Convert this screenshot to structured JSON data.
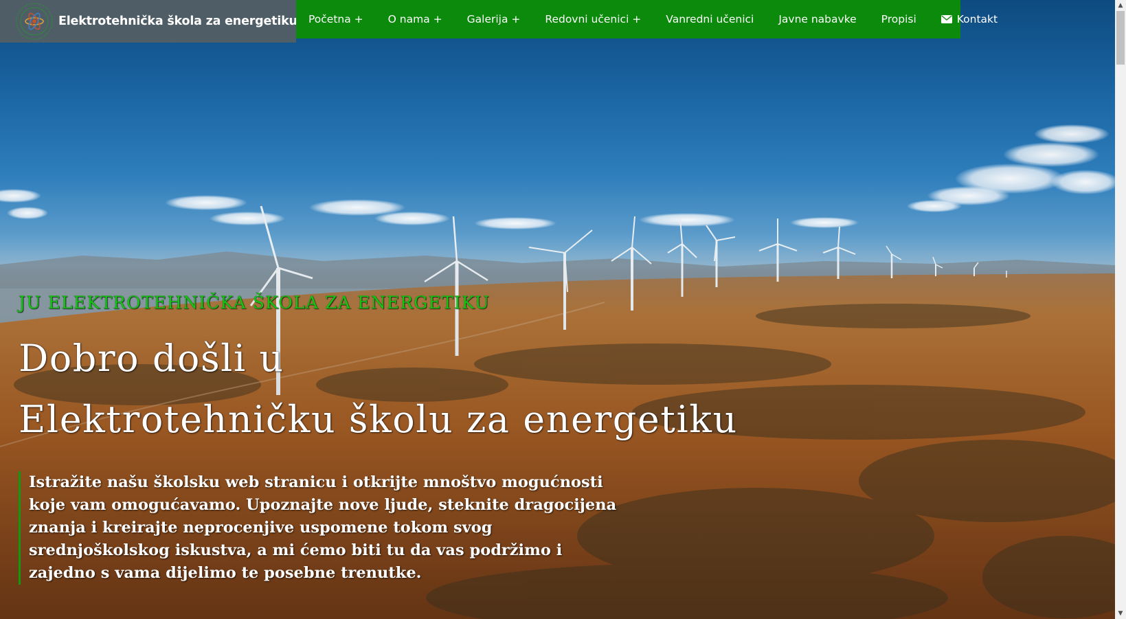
{
  "header": {
    "brand_title": "Elektrotehnička škola za energetiku",
    "logo_icon": "school-emblem-icon",
    "brand_background": "#555e64"
  },
  "nav": {
    "background": "#0b8a0b",
    "items": [
      {
        "label": "Početna +"
      },
      {
        "label": "O nama +"
      },
      {
        "label": "Galerija +"
      },
      {
        "label": "Redovni učenici +"
      },
      {
        "label": "Vanredni učenici"
      },
      {
        "label": "Javne nabavke"
      },
      {
        "label": "Propisi"
      },
      {
        "label": "Kontakt",
        "icon": "envelope-icon"
      }
    ]
  },
  "hero": {
    "kicker": "JU ELEKTROTEHNIČKA ŠKOLA ZA ENERGETIKU",
    "headline_line1": "Dobro došli u",
    "headline_line2": "Elektrotehničku školu za energetiku",
    "lead": "Istražite našu školsku web stranicu i otkrijte mnoštvo mogućnosti koje vam omogućavamo. Upoznajte nove ljude, steknite dragocijena znanja i kreirajte neprocenjive uspomene tokom svog srednjoškolskog iskustva, a mi ćemo biti tu da vas podržimo i zajedno s vama dijelimo te posebne trenutke.",
    "background_image": "wind-turbines-landscape",
    "kicker_color": "#16c416",
    "accent_color": "#119a11"
  },
  "scrollbar": {
    "up_icon": "scroll-up-arrow-icon",
    "down_icon": "scroll-down-arrow-icon"
  }
}
